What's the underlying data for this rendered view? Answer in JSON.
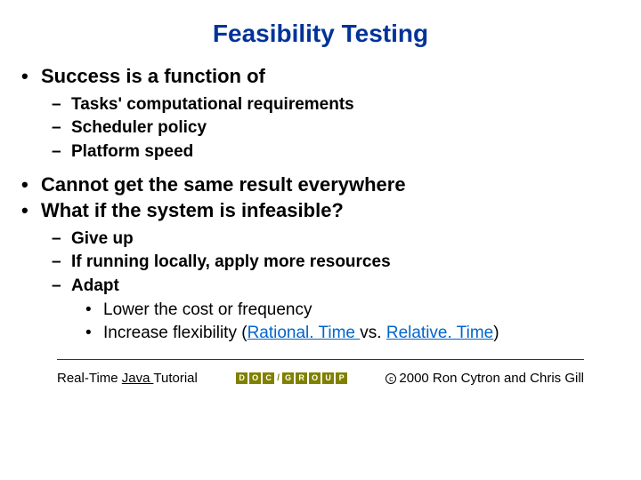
{
  "title": "Feasibility Testing",
  "bullets": {
    "b1": "Success is a function of",
    "b1_subs": {
      "s1": "Tasks' computational requirements",
      "s2": "Scheduler policy",
      "s3": "Platform speed"
    },
    "b2": "Cannot get the same result everywhere",
    "b3": "What if the system is infeasible?",
    "b3_subs": {
      "s1": "Give up",
      "s2": "If running locally, apply more resources",
      "s3": "Adapt",
      "s3_subs": {
        "t1a": "Lower the cost or frequency",
        "t2_prefix": "Increase flexibility (",
        "t2_link1": "Rational. Time ",
        "t2_mid": "vs. ",
        "t2_link2": "Relative. Time",
        "t2_suffix": ")"
      }
    }
  },
  "footer": {
    "left_prefix": "Real-Time ",
    "left_link": "Java ",
    "left_suffix": "Tutorial",
    "logo_letters": {
      "a": "D",
      "b": "O",
      "c": "C",
      "d": "G",
      "e": "R",
      "f": "O",
      "g": "U",
      "h": "P"
    },
    "right": "2000 Ron Cytron and Chris Gill"
  }
}
